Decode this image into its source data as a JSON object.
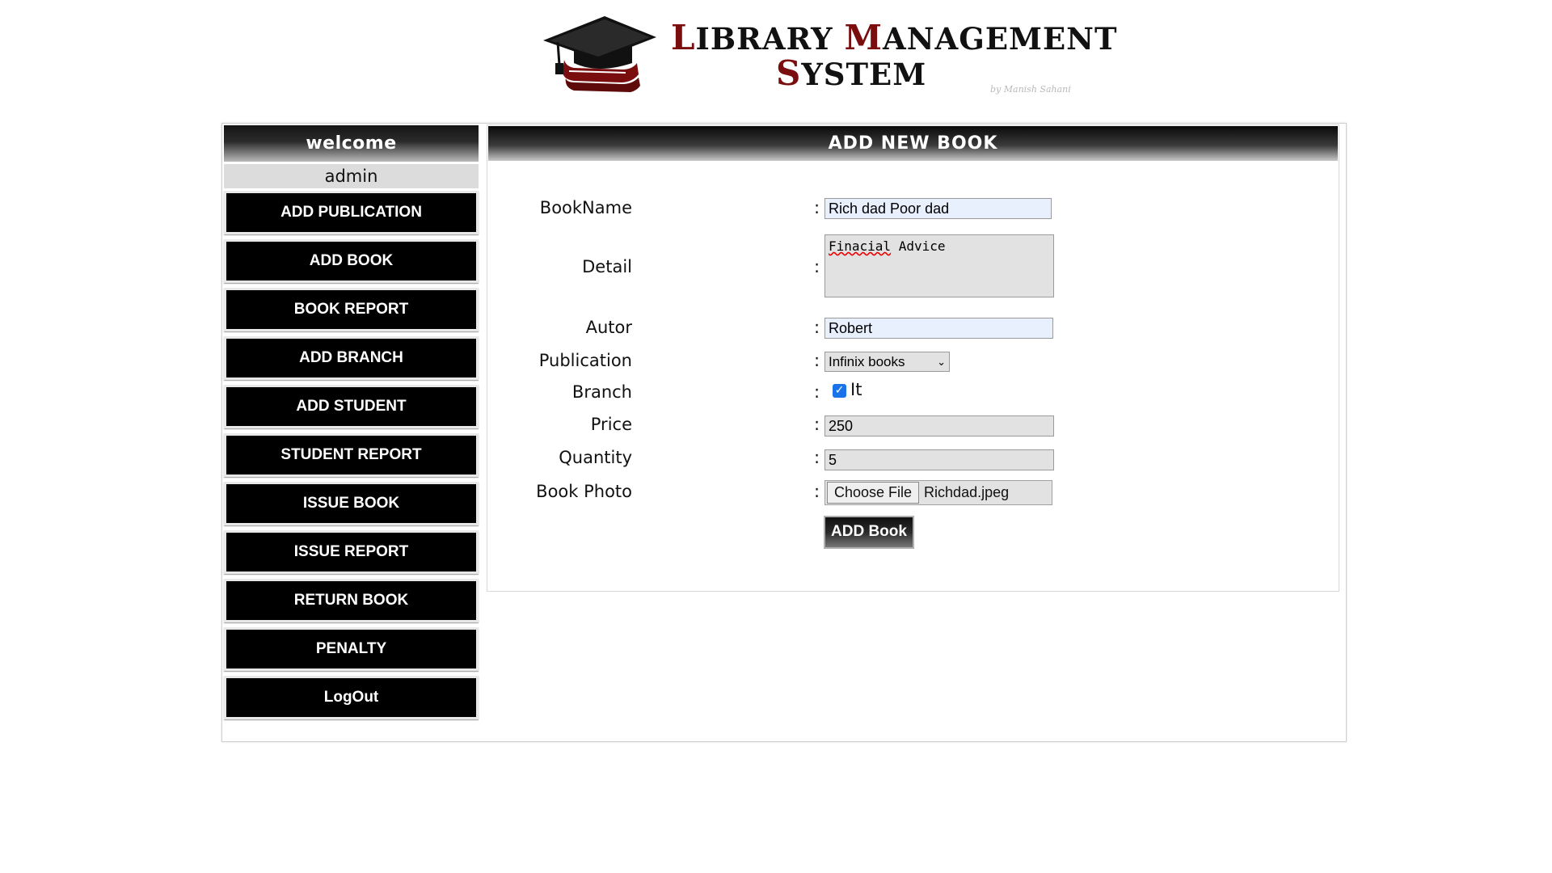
{
  "header": {
    "title_line1_caps": [
      "L",
      "M"
    ],
    "title_line1_rest": [
      "IBRARY ",
      "ANAGEMENT"
    ],
    "title_line2_cap": "S",
    "title_line2_rest": "YSTEM",
    "byline": "by Manish Sahani",
    "logo_icon": "graduation-cap-books-icon"
  },
  "sidebar": {
    "welcome": "welcome",
    "user": "admin",
    "items": [
      {
        "label": "ADD PUBLICATION"
      },
      {
        "label": "ADD BOOK"
      },
      {
        "label": "BOOK REPORT"
      },
      {
        "label": "ADD BRANCH"
      },
      {
        "label": "ADD STUDENT"
      },
      {
        "label": "STUDENT REPORT"
      },
      {
        "label": "ISSUE BOOK"
      },
      {
        "label": "ISSUE REPORT"
      },
      {
        "label": "RETURN BOOK"
      },
      {
        "label": "PENALTY"
      },
      {
        "label": "LogOut"
      }
    ]
  },
  "panel": {
    "title": "ADD NEW BOOK"
  },
  "form": {
    "colon": ":",
    "bookname": {
      "label": "BookName",
      "value": "Rich dad Poor dad"
    },
    "detail": {
      "label": "Detail",
      "value_misspelled": "Finacial",
      "value_rest": " Advice"
    },
    "author": {
      "label": "Autor",
      "value": "Robert"
    },
    "publication": {
      "label": "Publication",
      "selected": "Infinix books"
    },
    "branch": {
      "label": "Branch",
      "option": "It",
      "checked": true
    },
    "price": {
      "label": "Price",
      "value": "250"
    },
    "quantity": {
      "label": "Quantity",
      "value": "5"
    },
    "photo": {
      "label": "Book Photo",
      "button": "Choose File",
      "filename": "Richdad.jpeg"
    },
    "submit": "ADD Book"
  },
  "colors": {
    "accent_dark_red": "#7a0d0d",
    "checkbox_blue": "#1a73e8",
    "input_blue": "#e8f0fe"
  }
}
